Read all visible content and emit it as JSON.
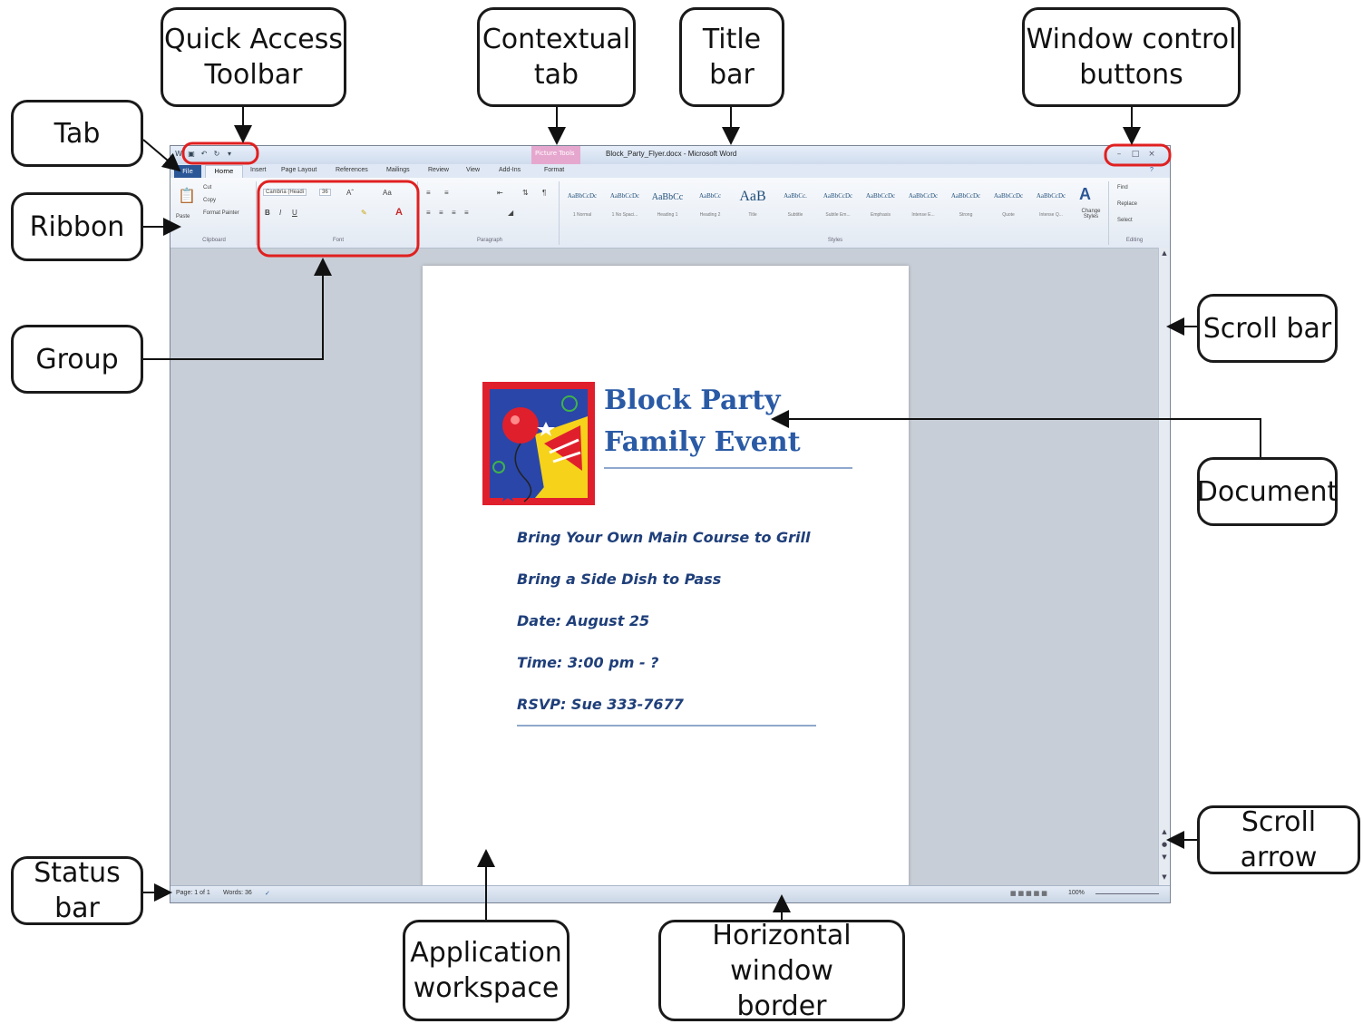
{
  "callouts": {
    "quick_access": "Quick Access\nToolbar",
    "contextual_tab": "Contextual\ntab",
    "title_bar": "Title\nbar",
    "window_controls": "Window control\nbuttons",
    "tab": "Tab",
    "ribbon": "Ribbon",
    "group": "Group",
    "scroll_bar": "Scroll bar",
    "document": "Document",
    "scroll_arrow": "Scroll arrow",
    "status_bar": "Status bar",
    "application_workspace": "Application\nworkspace",
    "horizontal_border": "Horizontal window\nborder"
  },
  "window": {
    "title": "Block_Party_Flyer.docx - Microsoft Word",
    "contextual_tab_label": "Picture Tools",
    "tabs": [
      "File",
      "Home",
      "Insert",
      "Page Layout",
      "References",
      "Mailings",
      "Review",
      "View",
      "Add-Ins",
      "Format"
    ]
  },
  "ribbon": {
    "clipboard": {
      "paste": "Paste",
      "cut": "Cut",
      "copy": "Copy",
      "format_painter": "Format Painter",
      "label": "Clipboard"
    },
    "font": {
      "name": "Cambria (Headi",
      "size": "36",
      "label": "Font"
    },
    "paragraph": {
      "label": "Paragraph"
    },
    "styles": {
      "label": "Styles",
      "items": [
        {
          "sample": "AaBbCcDc",
          "name": "1 Normal"
        },
        {
          "sample": "AaBbCcDc",
          "name": "1 No Spaci..."
        },
        {
          "sample": "AaBbCc",
          "name": "Heading 1"
        },
        {
          "sample": "AaBbCc",
          "name": "Heading 2"
        },
        {
          "sample": "AaB",
          "name": "Title"
        },
        {
          "sample": "AaBbCc.",
          "name": "Subtitle"
        },
        {
          "sample": "AaBbCcDc",
          "name": "Subtle Em..."
        },
        {
          "sample": "AaBbCcDc",
          "name": "Emphasis"
        },
        {
          "sample": "AaBbCcDc",
          "name": "Intense E..."
        },
        {
          "sample": "AaBbCcDc",
          "name": "Strong"
        },
        {
          "sample": "AaBbCcDc",
          "name": "Quote"
        },
        {
          "sample": "AaBbCcDc",
          "name": "Intense Q..."
        }
      ],
      "change_styles": "Change Styles"
    },
    "editing": {
      "find": "Find",
      "replace": "Replace",
      "select": "Select",
      "label": "Editing"
    }
  },
  "document": {
    "heading_line1": "Block Party",
    "heading_line2": "Family Event",
    "lines": [
      "Bring Your Own Main Course to Grill",
      "Bring a Side Dish to Pass",
      "Date:  August 25",
      "Time:  3:00 pm - ?",
      "RSVP:  Sue  333-7677"
    ]
  },
  "status": {
    "page": "Page: 1 of 1",
    "words": "Words: 36",
    "zoom": "100%"
  }
}
